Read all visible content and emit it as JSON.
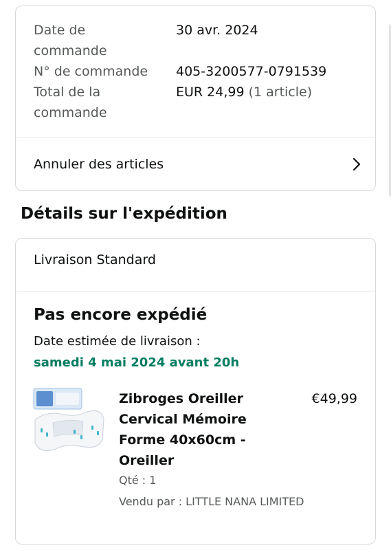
{
  "order_summary": {
    "rows": [
      {
        "label": "Date de\ncommande",
        "value": "30 avr. 2024",
        "muted": ""
      },
      {
        "label": "N° de commande",
        "value": "405-3200577-0791539",
        "muted": ""
      },
      {
        "label": "Total de la\ncommande",
        "value": "EUR 24,99",
        "muted": " (1 article)"
      }
    ],
    "cancel_label": "Annuler des articles"
  },
  "shipping": {
    "section_title": "Détails sur l'expédition",
    "method": "Livraison Standard",
    "status": "Pas encore expédié",
    "estimated_label": "Date estimée de livraison :",
    "estimated_date": "samedi 4 mai 2024 avant 20h",
    "estimated_date_color": "#067d62"
  },
  "product": {
    "title": "Zibroges Oreiller Cervical Mémoire Forme 40x60cm - Oreiller",
    "price": "€49,99",
    "quantity": "Qté : 1",
    "seller": "Vendu par : LITTLE NANA LIMITED",
    "image_icon": "pillow-product-image"
  },
  "icons": {
    "chevron": "chevron-right-icon"
  }
}
